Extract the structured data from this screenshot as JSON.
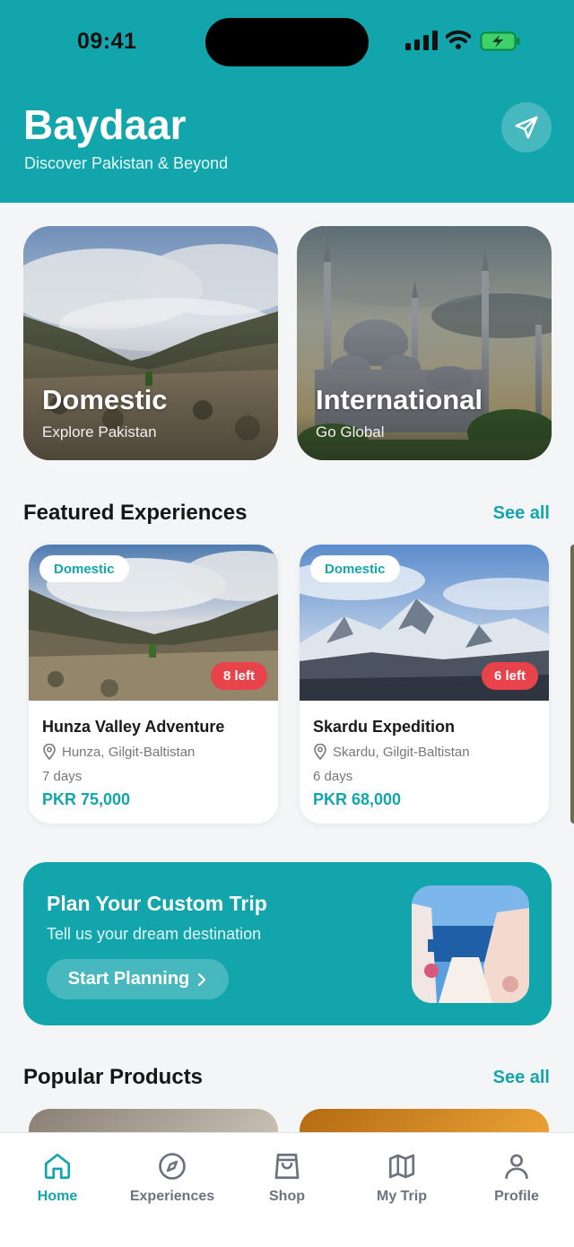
{
  "status_bar": {
    "time": "09:41"
  },
  "header": {
    "title": "Baydaar",
    "subtitle": "Discover Pakistan & Beyond",
    "action_icon": "send-icon"
  },
  "categories": [
    {
      "title": "Domestic",
      "subtitle": "Explore Pakistan"
    },
    {
      "title": "International",
      "subtitle": "Go Global"
    }
  ],
  "featured": {
    "heading": "Featured Experiences",
    "see_all": "See all",
    "items": [
      {
        "badge": "Domestic",
        "spots_left": "8 left",
        "title": "Hunza Valley Adventure",
        "location": "Hunza, Gilgit-Baltistan",
        "duration": "7 days",
        "price": "PKR 75,000"
      },
      {
        "badge": "Domestic",
        "spots_left": "6 left",
        "title": "Skardu Expedition",
        "location": "Skardu, Gilgit-Baltistan",
        "duration": "6 days",
        "price": "PKR 68,000"
      }
    ]
  },
  "custom_trip": {
    "title": "Plan Your Custom Trip",
    "subtitle": "Tell us your dream destination",
    "button_label": "Start Planning"
  },
  "products": {
    "heading": "Popular Products",
    "see_all": "See all"
  },
  "nav": {
    "active": "Home",
    "items": [
      {
        "label": "Home",
        "icon": "home-icon"
      },
      {
        "label": "Experiences",
        "icon": "compass-icon"
      },
      {
        "label": "Shop",
        "icon": "shopping-bag-icon"
      },
      {
        "label": "My Trip",
        "icon": "map-icon"
      },
      {
        "label": "Profile",
        "icon": "user-icon"
      }
    ]
  },
  "colors": {
    "accent": "#12a5ac",
    "danger_badge": "#e8424a",
    "background": "#f4f5f7"
  }
}
